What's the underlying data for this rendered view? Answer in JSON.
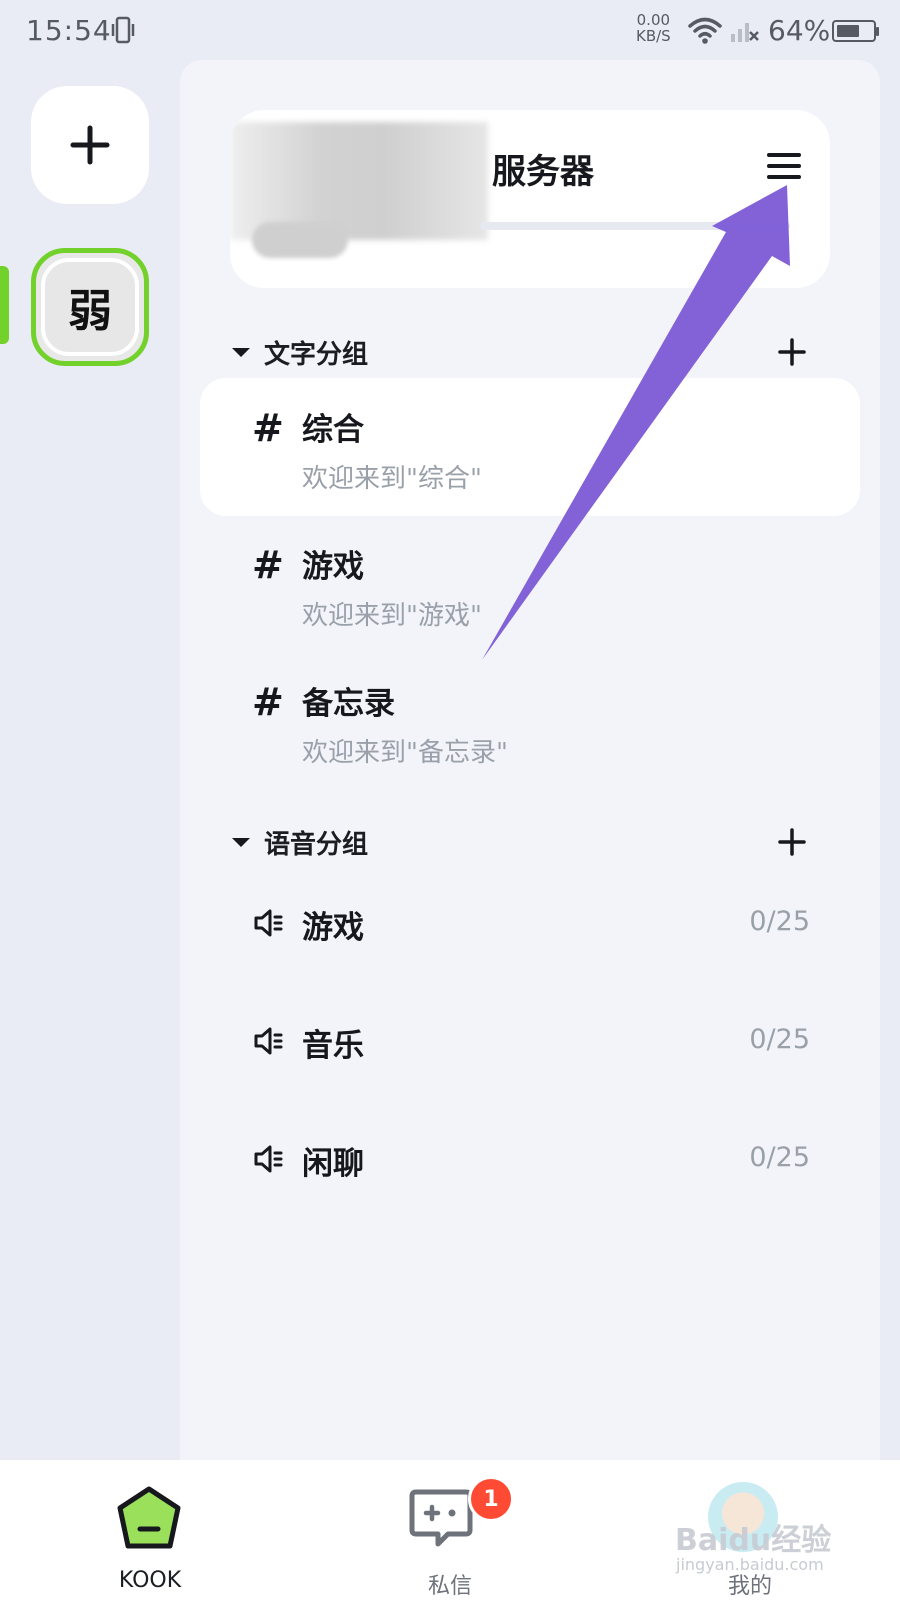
{
  "status_bar": {
    "time": "15:54",
    "net_speed_value": "0.00",
    "net_speed_unit": "KB/S",
    "battery_text": "64%",
    "battery_level": 0.64
  },
  "left_rail": {
    "add_icon": "plus-icon",
    "server_initial": "弱"
  },
  "header": {
    "server_name_suffix": "服务器",
    "menu_icon": "hamburger-menu-icon"
  },
  "text_group": {
    "title": "文字分组",
    "channels": [
      {
        "name": "综合",
        "desc": "欢迎来到\"综合\""
      },
      {
        "name": "游戏",
        "desc": "欢迎来到\"游戏\""
      },
      {
        "name": "备忘录",
        "desc": "欢迎来到\"备忘录\""
      }
    ]
  },
  "voice_group": {
    "title": "语音分组",
    "channels": [
      {
        "name": "游戏",
        "count": "0/25"
      },
      {
        "name": "音乐",
        "count": "0/25"
      },
      {
        "name": "闲聊",
        "count": "0/25"
      }
    ]
  },
  "bottom_nav": {
    "items": [
      {
        "label": "KOOK",
        "icon": "kook-home-icon"
      },
      {
        "label": "私信",
        "icon": "gamepad-chat-icon",
        "badge": "1"
      },
      {
        "label": "我的",
        "icon": "avatar"
      }
    ]
  },
  "watermark": {
    "text": "Baidu经验",
    "url": "jingyan.baidu.com"
  },
  "colors": {
    "accent_green": "#72d12a",
    "arrow_purple": "#7e5cd6",
    "badge_red": "#ff4b33",
    "panel_bg": "#f2f4fa"
  }
}
